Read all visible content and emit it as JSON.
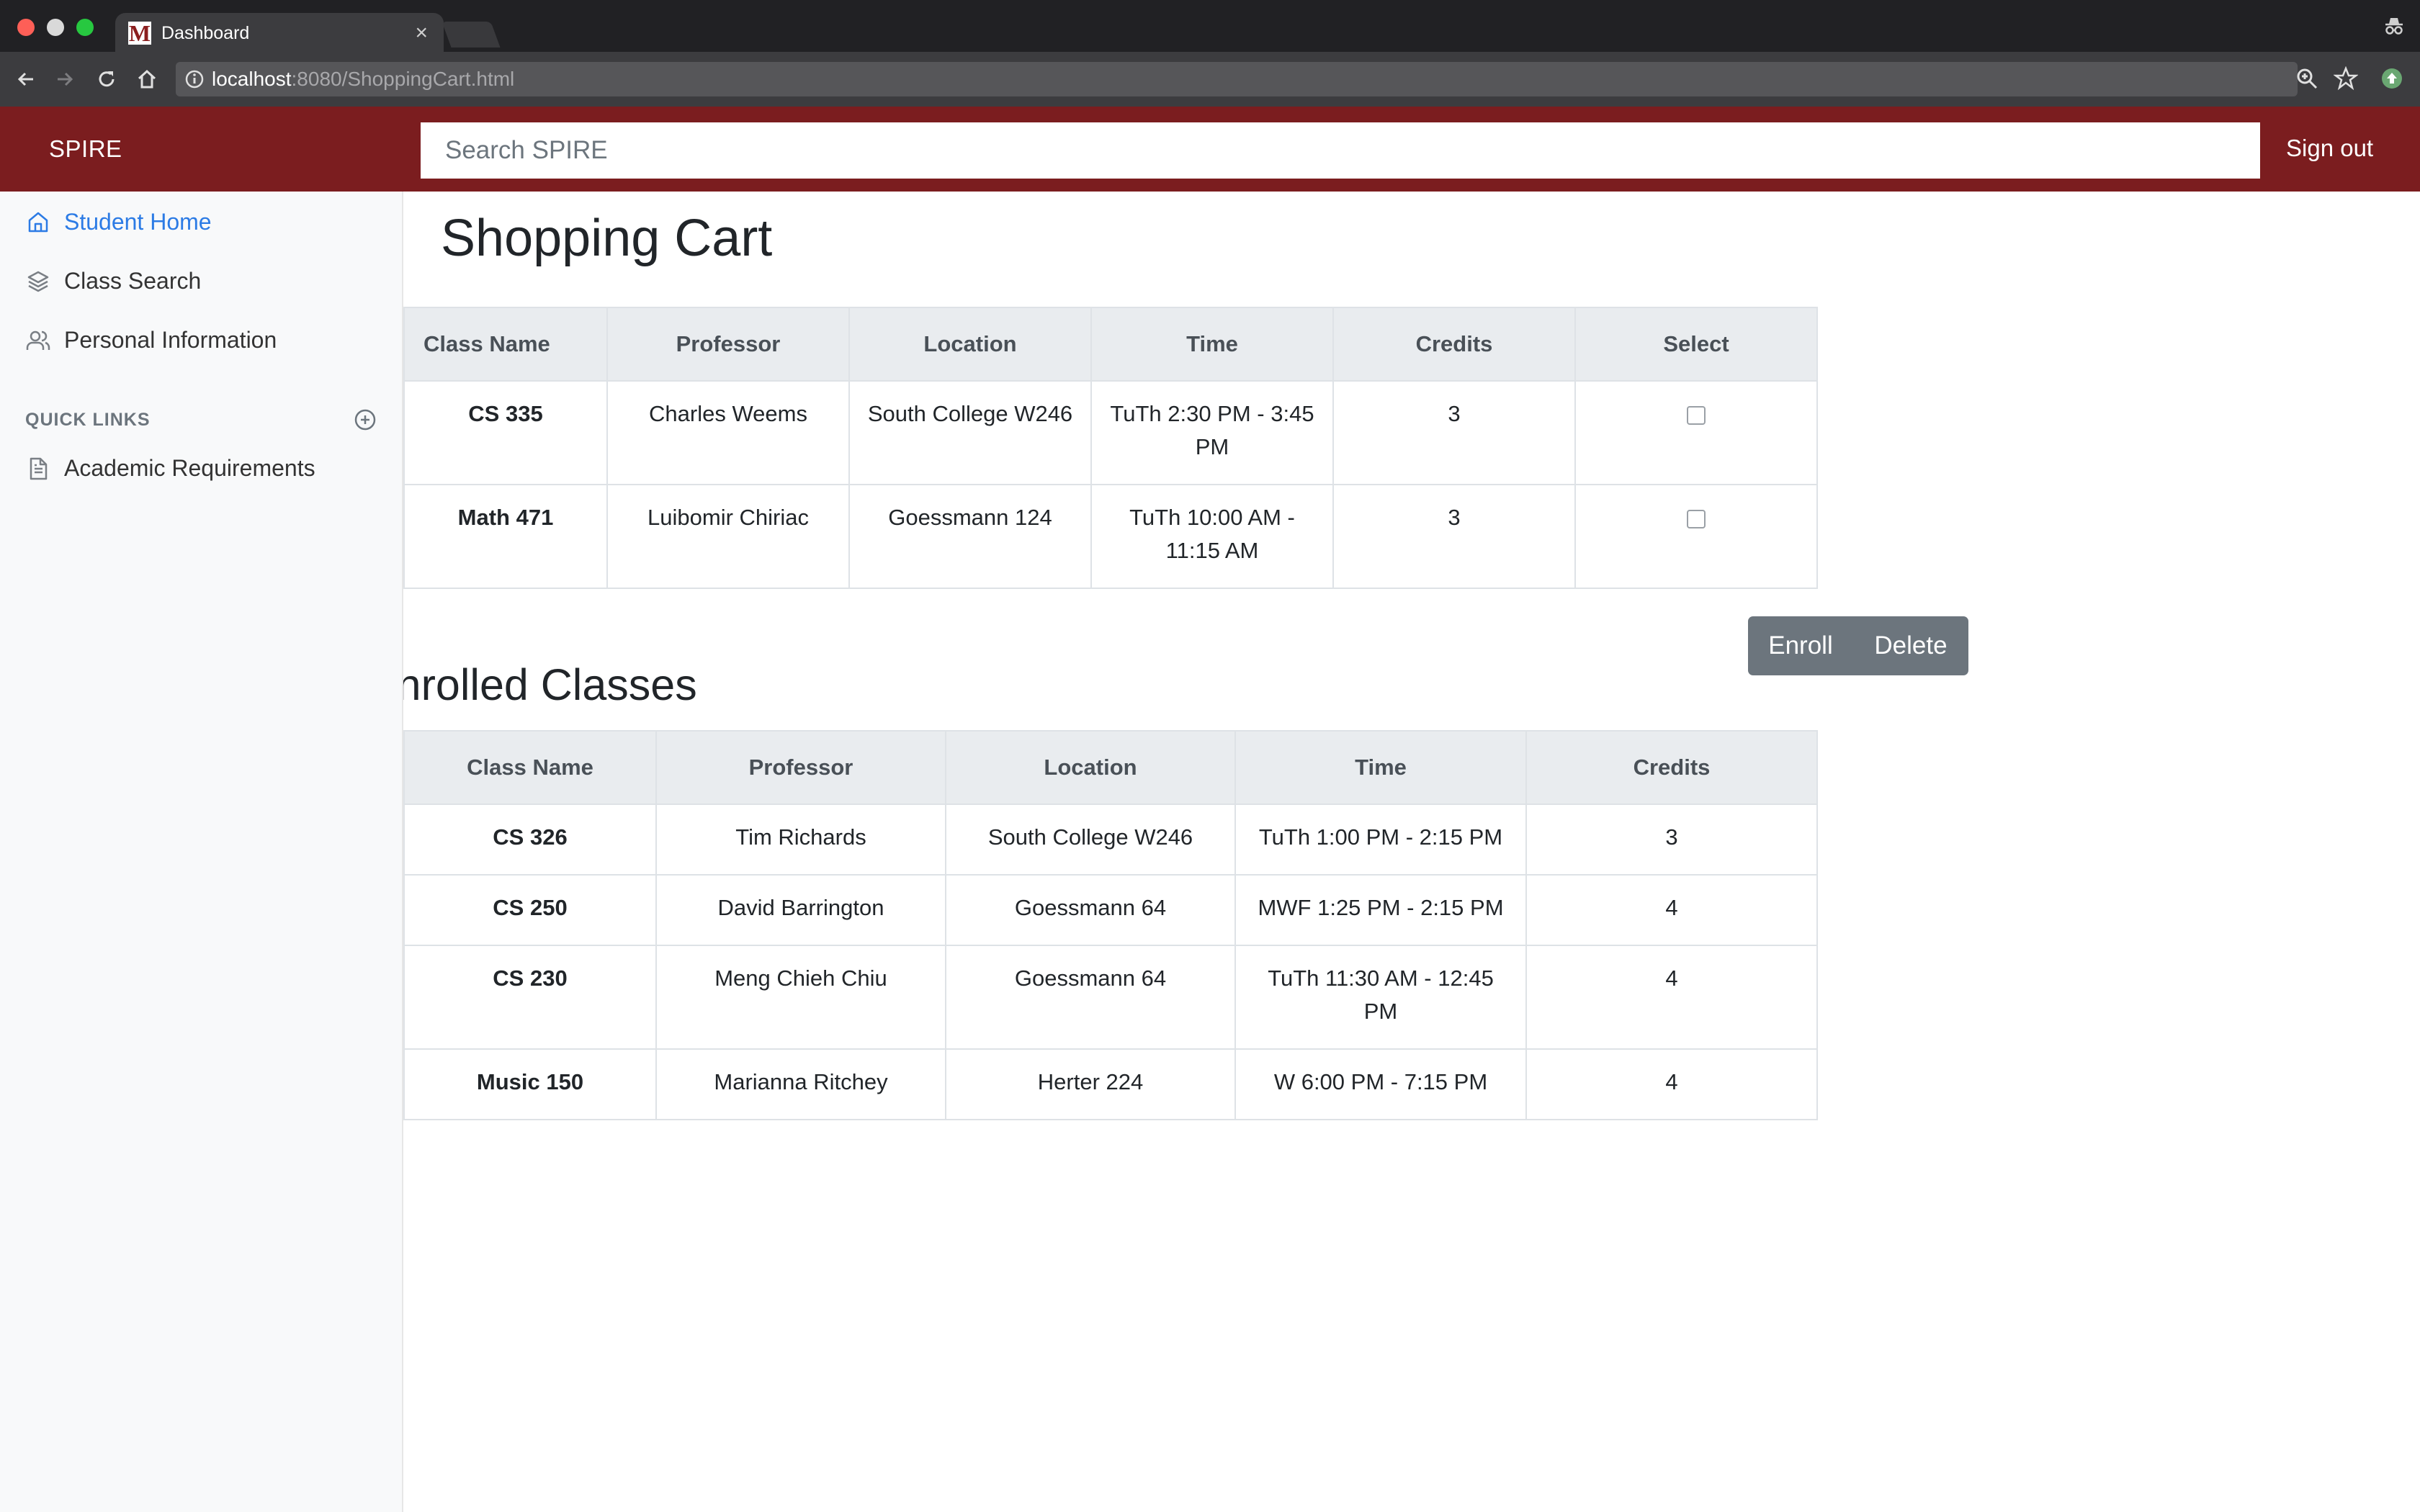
{
  "browser": {
    "tab_title": "Dashboard",
    "favicon_letter": "M",
    "url_host": "localhost",
    "url_rest": ":8080/ShoppingCart.html"
  },
  "header": {
    "brand": "SPIRE",
    "search_placeholder": "Search SPIRE",
    "signout": "Sign out",
    "brand_color": "#7b1d1f"
  },
  "sidebar": {
    "items": [
      {
        "label": "Student Home",
        "icon": "home-icon",
        "active": true
      },
      {
        "label": "Class Search",
        "icon": "layers-icon",
        "active": false
      },
      {
        "label": "Personal Information",
        "icon": "users-icon",
        "active": false
      }
    ],
    "quick_links_title": "QUICK LINKS",
    "quick_links": [
      {
        "label": "Academic Requirements",
        "icon": "file-text-icon"
      }
    ]
  },
  "cart": {
    "title": "Shopping Cart",
    "columns": [
      "Class Name",
      "Professor",
      "Location",
      "Time",
      "Credits",
      "Select"
    ],
    "rows": [
      {
        "class_name": "CS 335",
        "professor": "Charles Weems",
        "location": "South College W246",
        "time": "TuTh 2:30 PM - 3:45 PM",
        "credits": "3",
        "selected": false
      },
      {
        "class_name": "Math 471",
        "professor": "Luibomir Chiriac",
        "location": "Goessmann 124",
        "time": "TuTh 10:00 AM - 11:15 AM",
        "credits": "3",
        "selected": false
      }
    ],
    "enroll_label": "Enroll",
    "delete_label": "Delete"
  },
  "enrolled": {
    "title": "Enrolled Classes",
    "columns": [
      "Class Name",
      "Professor",
      "Location",
      "Time",
      "Credits"
    ],
    "rows": [
      {
        "class_name": "CS 326",
        "professor": "Tim Richards",
        "location": "South College W246",
        "time": "TuTh 1:00 PM - 2:15 PM",
        "credits": "3"
      },
      {
        "class_name": "CS 250",
        "professor": "David Barrington",
        "location": "Goessmann 64",
        "time": "MWF 1:25 PM - 2:15 PM",
        "credits": "4"
      },
      {
        "class_name": "CS 230",
        "professor": "Meng Chieh Chiu",
        "location": "Goessmann 64",
        "time": "TuTh 11:30 AM - 12:45 PM",
        "credits": "4"
      },
      {
        "class_name": "Music 150",
        "professor": "Marianna Ritchey",
        "location": "Herter 224",
        "time": "W 6:00 PM - 7:15 PM",
        "credits": "4"
      }
    ]
  }
}
